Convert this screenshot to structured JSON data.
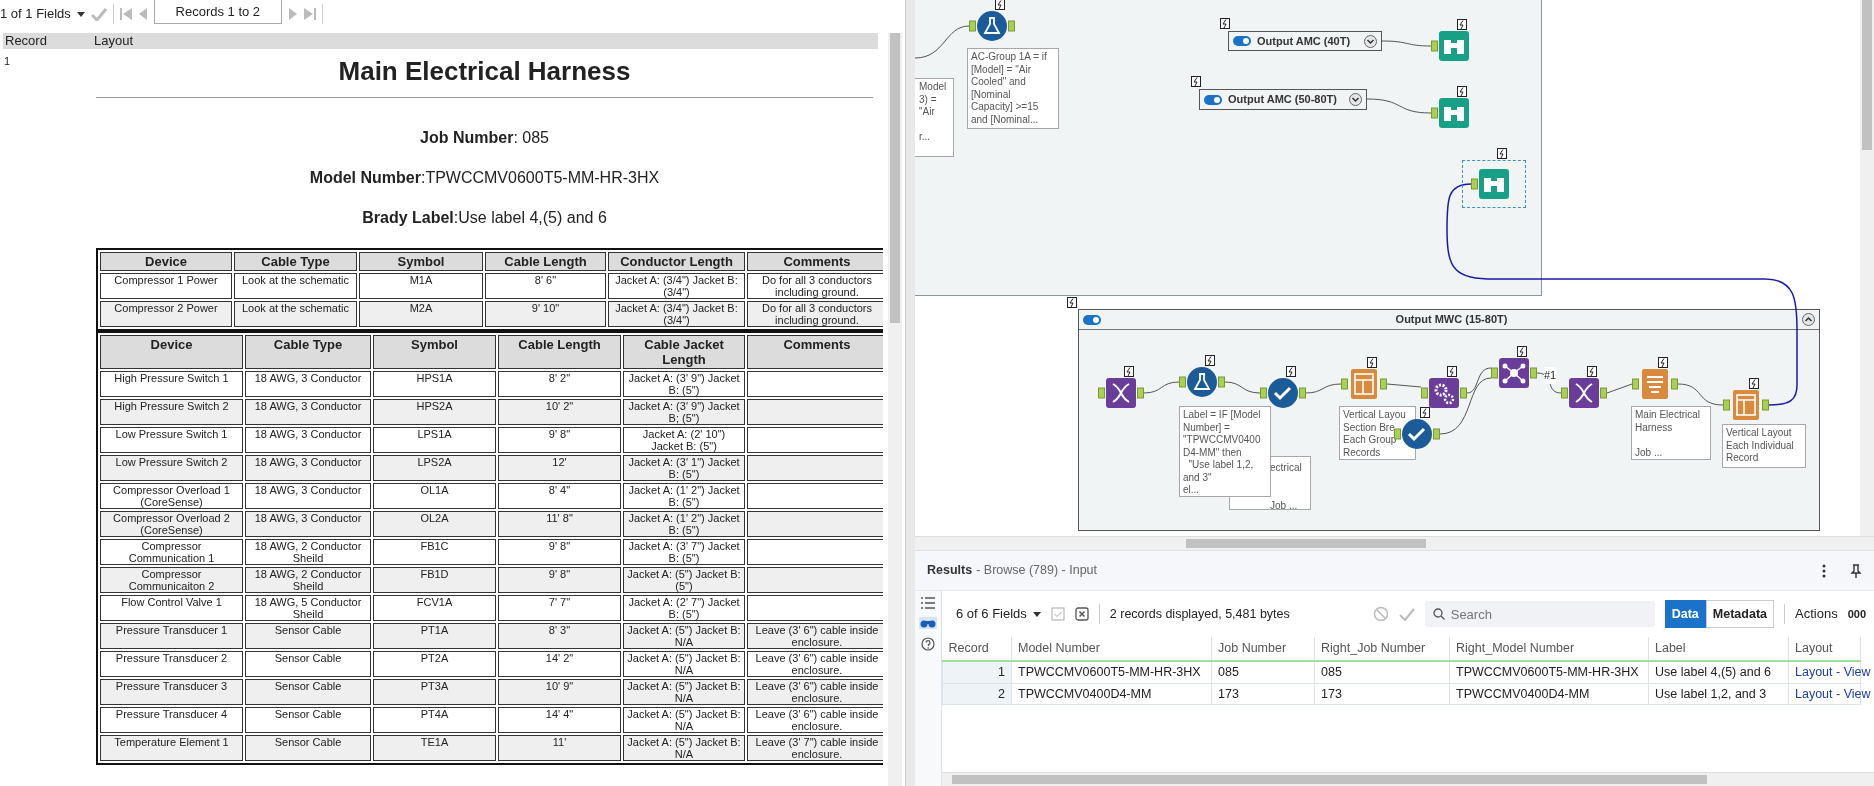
{
  "browse_toolbar": {
    "fields": "1 of 1 Fields",
    "records": "Records 1 to 2"
  },
  "browse_grid": {
    "columns": [
      "Record",
      "Layout"
    ],
    "record": "1"
  },
  "report": {
    "title": "Main Electrical Harness",
    "info": [
      "**Job Number**: 085",
      "**Model Number**:TPWCCMV0600T5-MM-HR-3HX",
      "**Brady Label**:Use label 4,(5) and 6"
    ],
    "tables": [
      {
        "columns": [
          "Device",
          "Cable Type",
          "Symbol",
          "Cable Length",
          "Conductor Length",
          "Comments"
        ],
        "rows": [
          [
            "Compressor 1 Power",
            "Look at the schematic",
            "M1A",
            "8' 6\"",
            "Jacket A: (3/4\") Jacket B: (3/4\")",
            "Do for all 3 conductors including ground."
          ],
          [
            "Compressor 2 Power",
            "Look at the schematic",
            "M2A",
            "9' 10\"",
            "Jacket A: (3/4\") Jacket B: (3/4\")",
            "Do for all 3 conductors including ground."
          ]
        ]
      },
      {
        "columns": [
          "Device",
          "Cable Type",
          "Symbol",
          "Cable Length",
          "Cable Jacket Length",
          "Comments"
        ],
        "rows": [
          [
            "High Pressure Switch 1",
            "18 AWG, 3 Conductor",
            "HPS1A",
            "8' 2\"",
            "Jacket A: (3' 9\") Jacket B: (5\")"
          ],
          [
            "High Pressure Switch 2",
            "18 AWG, 3 Conductor",
            "HPS2A",
            "10' 2\"",
            "Jacket A: (3' 9\") Jacket B; (5\")"
          ],
          [
            "Low Pressure Switch 1",
            "18 AWG, 3 Conductor",
            "LPS1A",
            "9' 8\"",
            "Jacket A: (2' 10\") Jacket B: (5\")"
          ],
          [
            "Low Pressure Switch 2",
            "18 AWG, 3 Conductor",
            "LPS2A",
            "12'",
            "Jacket A: (3' 1\") Jacket B: (5\")"
          ],
          [
            "Compressor Overload 1 (CoreSense)",
            "18 AWG, 3 Conductor",
            "OL1A",
            "8' 4\"",
            "Jacket A: (1' 2\") Jacket B: (5\")"
          ],
          [
            "Compressor Overload 2 (CoreSense)",
            "18 AWG, 3 Conductor",
            "OL2A",
            "11' 8\"",
            "Jacket A: (1' 2\") Jacket B: (5\")"
          ],
          [
            "Compressor Communication 1",
            "18 AWG, 2 Conductor Sheild",
            "FB1C",
            "9' 8\"",
            "Jacket A: (3' 7\") Jacket B: (5\")"
          ],
          [
            "Compressor Communicaiton 2",
            "18 AWG, 2 Conductor Sheild",
            "FB1D",
            "9' 8\"",
            "Jacket A: (5\") Jacket B: (5\")"
          ],
          [
            "Flow Control Valve 1",
            "18 AWG, 5 Conductor Sheild",
            "FCV1A",
            "7' 7\"",
            "Jacket A: (2' 7\") Jacket B: (5\")"
          ],
          [
            "Pressure Transducer 1",
            "Sensor Cable",
            "PT1A",
            "8' 3\"",
            "Jacket A: (5\") Jacket B: N/A",
            "Leave (3' 6\") cable inside enclosure."
          ],
          [
            "Pressure Transducer 2",
            "Sensor Cable",
            "PT2A",
            "14' 2\"",
            "Jacket A: (5\") Jacket B: N/A",
            "Leave (3' 6\") cable inside enclosure."
          ],
          [
            "Pressure Transducer 3",
            "Sensor Cable",
            "PT3A",
            "10' 9\"",
            "Jacket A: (5\") Jacket B: N/A",
            "Leave (3' 6\") cable inside enclosure."
          ],
          [
            "Pressure Transducer 4",
            "Sensor Cable",
            "PT4A",
            "14' 4\"",
            "Jacket A: (5\") Jacket B: N/A",
            "Leave (3' 6\") cable inside enclosure."
          ],
          [
            "Temperature Element 1",
            "Sensor Cable",
            "TE1A",
            "11'",
            "Jacket A: (5\") Jacket B: N/A",
            "Leave (3' 7\") cable inside enclosure."
          ]
        ]
      }
    ]
  },
  "canvas": {
    "containers": [
      {
        "title": "Output AMC (40T)",
        "on": true,
        "expanded": false
      },
      {
        "title": "Output AMC (50-80T)",
        "on": true,
        "expanded": false
      },
      {
        "title": "Output MWC (15-80T)",
        "on": true,
        "expanded": true
      }
    ],
    "annotations": [
      {
        "text": "Model\n3) =\n\"Air\n\nr..."
      },
      {
        "text": "AC-Group 1A = if\n[Model] = \"Air\nCooled\" and\n[Nominal\nCapacity] >=15\nand [Nominal..."
      },
      {
        "text": "ectrical\n\n\nJob ..."
      },
      {
        "text": "Label = IF [Model\nNumber] =\n\"TPWCCMV0400\nD4-MM\" then\n  \"Use label 1,2,\nand 3\"\nel..."
      },
      {
        "text": "Vertical Layou\nSection Bre\nEach Group\nRecords"
      },
      {
        "text": "Main Electrical\nHarness\n\nJob ..."
      },
      {
        "text": "Vertical Layout\nEach Individual\nRecord"
      }
    ],
    "tools": [
      {
        "kind": "flask",
        "selected": false
      },
      {
        "kind": "browse",
        "selected": false
      },
      {
        "kind": "browse",
        "selected": false
      },
      {
        "kind": "browse",
        "selected": true
      },
      {
        "kind": "dna",
        "selected": false
      },
      {
        "kind": "flask",
        "selected": false
      },
      {
        "kind": "check",
        "selected": false
      },
      {
        "kind": "report",
        "selected": false
      },
      {
        "kind": "gear",
        "selected": false
      },
      {
        "kind": "join",
        "selected": false
      },
      {
        "kind": "dna",
        "selected": false
      },
      {
        "kind": "text",
        "selected": false
      },
      {
        "kind": "layout",
        "selected": false
      },
      {
        "kind": "check",
        "selected": false
      }
    ],
    "labels": [
      "#1"
    ]
  },
  "results": {
    "title": "Results",
    "subtitle": "- Browse (789) - Input",
    "fields": "6 of 6 Fields",
    "summary": "2 records displayed, 5,481 bytes",
    "search_placeholder": "Search",
    "views": [
      {
        "label": "Data",
        "selected": true
      },
      {
        "label": "Metadata",
        "selected": false
      }
    ],
    "actions": "Actions",
    "more": "000",
    "columns": [
      {
        "label": "Record",
        "kind": "number"
      },
      {
        "label": "Model Number",
        "kind": "text"
      },
      {
        "label": "Job Number",
        "kind": "text"
      },
      {
        "label": "Right_Job Number",
        "kind": "text"
      },
      {
        "label": "Right_Model Number",
        "kind": "text"
      },
      {
        "label": "Label",
        "kind": "text"
      },
      {
        "label": "Layout",
        "kind": "link"
      }
    ],
    "rows": [
      [
        "1",
        "TPWCCMV0600T5-MM-HR-3HX",
        "085",
        "085",
        "TPWCCMV0600T5-MM-HR-3HX",
        "Use label 4,(5) and 6",
        "Layout - View"
      ],
      [
        "2",
        "TPWCCMV0400D4-MM",
        "173",
        "173",
        "TPWCCMV0400D4-MM",
        "Use label 1,2, and 3",
        "Layout - View"
      ]
    ]
  }
}
